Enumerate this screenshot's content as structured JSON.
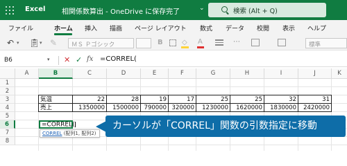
{
  "titlebar": {
    "app_name": "Excel",
    "doc_title": "相関係数算出 - OneDrive に保存完了",
    "chevron": "⌄",
    "search_placeholder": "検索 (Alt + Q)"
  },
  "ribbon": {
    "tabs": [
      "ファイル",
      "ホーム",
      "挿入",
      "描画",
      "ページ レイアウト",
      "数式",
      "データ",
      "校閲",
      "表示",
      "ヘルプ"
    ],
    "active_tab": "ホーム"
  },
  "toolbar": {
    "undo_icon": "undo-icon",
    "paste_icon": "clipboard-icon",
    "font_name": "ＭＳ Ｐゴシック",
    "font_size": "",
    "number_format": "標準"
  },
  "formula_bar": {
    "name_box": "B6",
    "fx_label": "fx",
    "formula": "=CORREL("
  },
  "grid": {
    "columns": [
      "A",
      "B",
      "C",
      "D",
      "E",
      "F",
      "G",
      "H",
      "I",
      "J",
      "K"
    ],
    "selected_column": "B",
    "rows": [
      "1",
      "2",
      "3",
      "4",
      "5",
      "6",
      "7",
      "8"
    ],
    "selected_row": "6"
  },
  "table": {
    "row3": {
      "label": "気温",
      "values": [
        "22",
        "28",
        "19",
        "17",
        "25",
        "25",
        "32",
        "31"
      ]
    },
    "row4": {
      "label": "売上",
      "values": [
        "1350000",
        "1500000",
        "790000",
        "320000",
        "1230000",
        "1620000",
        "1830000",
        "2420000"
      ]
    }
  },
  "active_cell": {
    "text": "=CORREL("
  },
  "tooltip": {
    "function": "CORREL",
    "args": " (配列1, 配列2)"
  },
  "callout": {
    "text": "カーソルが「CORREL」関数の引数指定に移動"
  },
  "colors": {
    "brand": "#107c41",
    "callout": "#0e6da8"
  }
}
